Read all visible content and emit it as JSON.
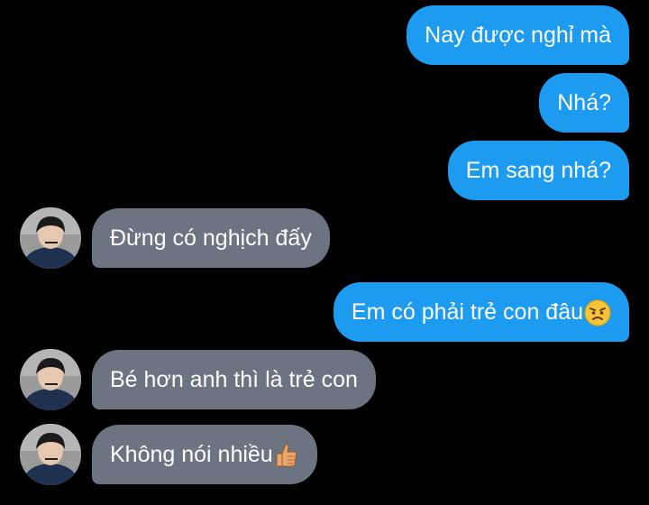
{
  "messages": [
    {
      "text": "Nay được nghỉ mà"
    },
    {
      "text": "Nhá?"
    },
    {
      "text": "Em sang nhá?"
    },
    {
      "text": "Đừng có nghịch đấy"
    },
    {
      "text": "Em có phải trẻ con đâu",
      "emoji": "angry-face-emoji"
    },
    {
      "text": "Bé hơn anh thì là trẻ con"
    },
    {
      "text": "Không nói nhiều",
      "emoji": "thumbs-up-emoji"
    }
  ],
  "colors": {
    "background": "#000000",
    "outgoing_bubble": "#1d9bf0",
    "incoming_bubble": "#6b7480",
    "text": "#ffffff"
  }
}
